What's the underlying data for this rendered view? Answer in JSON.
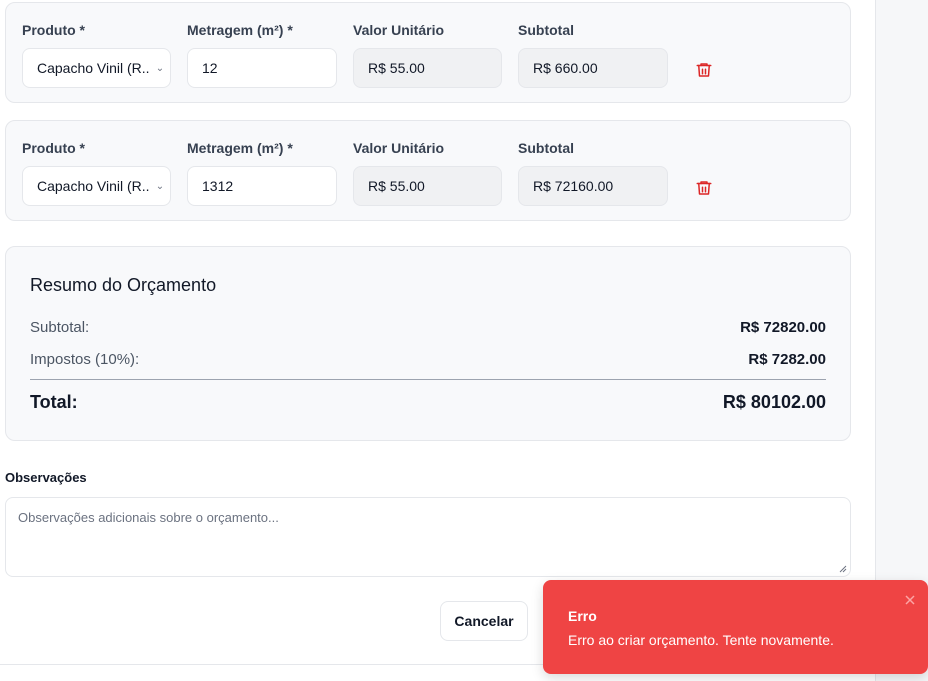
{
  "items": [
    {
      "product_label": "Produto *",
      "product_value": "Capacho Vinil (R...",
      "area_label": "Metragem (m²) *",
      "area_value": "12",
      "unit_label": "Valor Unitário",
      "unit_value": "R$ 55.00",
      "subtotal_label": "Subtotal",
      "subtotal_value": "R$ 660.00"
    },
    {
      "product_label": "Produto *",
      "product_value": "Capacho Vinil (R...",
      "area_label": "Metragem (m²) *",
      "area_value": "1312",
      "unit_label": "Valor Unitário",
      "unit_value": "R$ 55.00",
      "subtotal_label": "Subtotal",
      "subtotal_value": "R$ 72160.00"
    }
  ],
  "summary": {
    "title": "Resumo do Orçamento",
    "subtotal_label": "Subtotal:",
    "subtotal_value": "R$ 72820.00",
    "tax_label": "Impostos (10%):",
    "tax_value": "R$ 7282.00",
    "total_label": "Total:",
    "total_value": "R$ 80102.00"
  },
  "notes": {
    "label": "Observações",
    "placeholder": "Observações adicionais sobre o orçamento..."
  },
  "actions": {
    "cancel_label": "Cancelar"
  },
  "toast": {
    "title": "Erro",
    "message": "Erro ao criar orçamento. Tente novamente."
  },
  "colors": {
    "danger": "#ef4444",
    "trash": "#dc2626",
    "card_bg": "#f8f9fb",
    "readonly_bg": "#f0f1f3"
  }
}
